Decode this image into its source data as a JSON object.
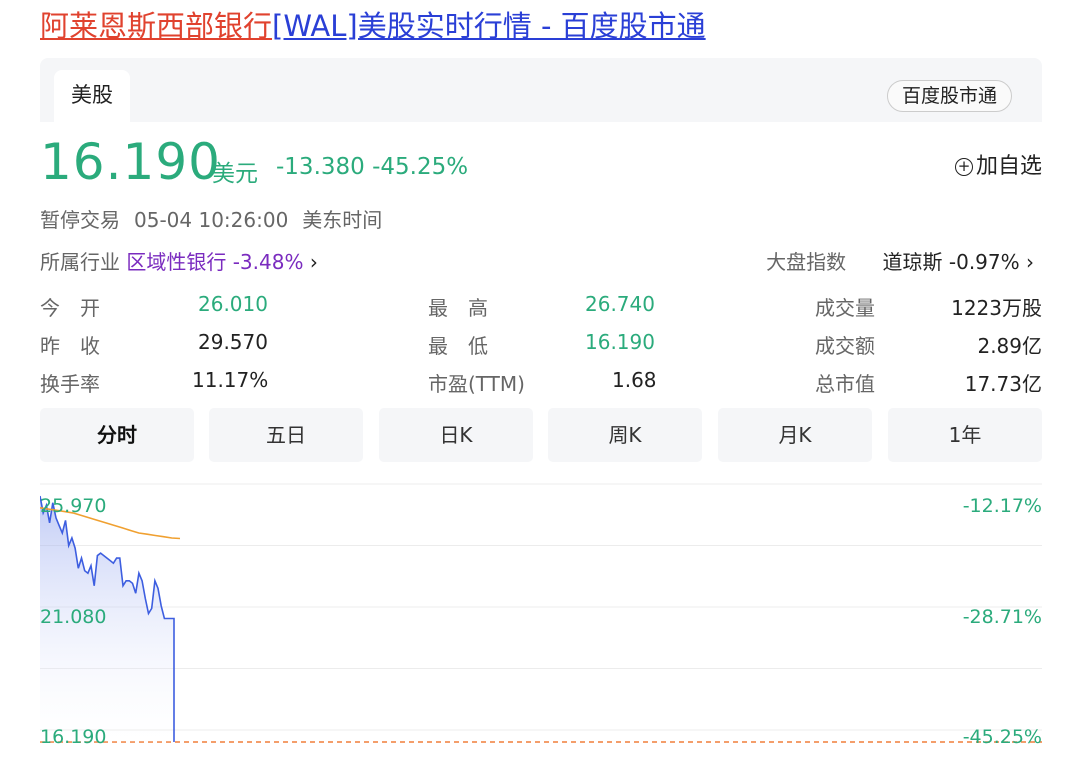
{
  "title": {
    "part1": "阿莱恩斯西部银行",
    "part2": "[WAL]美股实时行情 - 百度股市通"
  },
  "tab": "美股",
  "source_pill": "百度股市通",
  "price": "16.190",
  "currency": "美元",
  "change": "-13.380",
  "change_pct": "-45.25%",
  "favorite": "加自选",
  "status": {
    "state": "暂停交易",
    "time": "05-04 10:26:00",
    "zone": "美东时间"
  },
  "industry": {
    "label": "所属行业",
    "name": "区域性银行",
    "pct": "-3.48%"
  },
  "index": {
    "label": "大盘指数",
    "name": "道琼斯",
    "pct": "-0.97%"
  },
  "stats": [
    {
      "label": "今　开",
      "value": "26.010",
      "color": "#2bab7c"
    },
    {
      "label": "最　高",
      "value": "26.740",
      "color": "#2bab7c"
    },
    {
      "label": "成交量",
      "value": "1223万股",
      "color": "#222222"
    },
    {
      "label": "昨　收",
      "value": "29.570",
      "color": "#222222"
    },
    {
      "label": "最　低",
      "value": "16.190",
      "color": "#2bab7c"
    },
    {
      "label": "成交额",
      "value": "2.89亿",
      "color": "#222222"
    },
    {
      "label": "换手率",
      "value": "11.17%",
      "color": "#222222"
    },
    {
      "label": "市盈(TTM)",
      "value": "1.68",
      "color": "#222222"
    },
    {
      "label": "总市值",
      "value": "17.73亿",
      "color": "#222222"
    }
  ],
  "chart_tabs": [
    "分时",
    "五日",
    "日K",
    "周K",
    "月K",
    "1年"
  ],
  "chart_data": {
    "type": "line",
    "ylabels_left": [
      "25.970",
      "21.080",
      "16.190"
    ],
    "ylabels_right": [
      "-12.17%",
      "-28.71%",
      "-45.25%"
    ],
    "ylim": [
      16.19,
      25.97
    ],
    "prev_close_fraction": 0,
    "series": [
      {
        "values": [
          25.97,
          25.3,
          25.6,
          24.9,
          25.7,
          25.1,
          24.8,
          24.5,
          25.0,
          24.0,
          24.3,
          23.9,
          23.1,
          23.5,
          23.0,
          22.9,
          23.2,
          22.4,
          23.6,
          23.7,
          23.6,
          23.5,
          23.4,
          23.3,
          23.5,
          23.5,
          22.4,
          22.6,
          22.6,
          22.5,
          22.1,
          22.9,
          22.6,
          21.9,
          21.3,
          21.5,
          22.6,
          22.3,
          21.6,
          21.1,
          21.1,
          21.1,
          21.1,
          16.19
        ],
        "color": "#3d5ee0"
      },
      {
        "values": [
          25.5,
          25.45,
          25.4,
          25.35,
          25.3,
          25.2,
          25.1,
          25.0,
          24.9,
          24.8,
          24.7,
          24.6,
          24.5,
          24.45,
          24.4,
          24.35,
          24.3,
          24.28
        ],
        "color": "#f0a030"
      }
    ]
  }
}
